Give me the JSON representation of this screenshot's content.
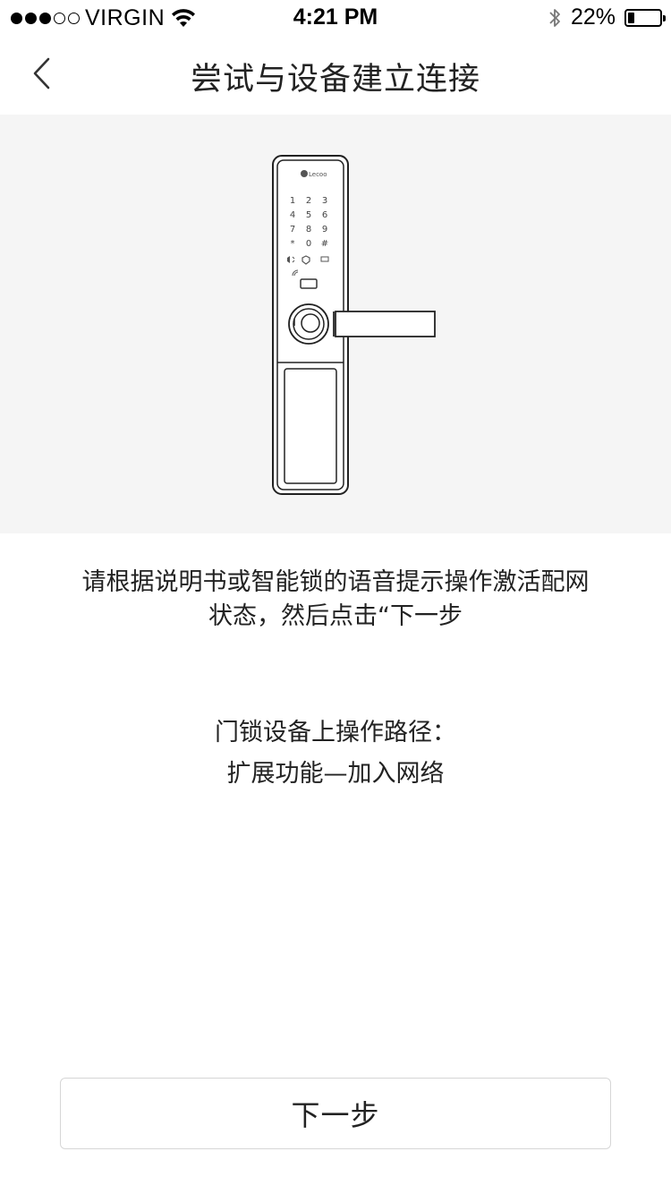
{
  "status_bar": {
    "carrier": "VIRGIN",
    "time": "4:21 PM",
    "battery_text": "22%",
    "battery_level": 0.22,
    "signal_filled": 3,
    "signal_total": 5
  },
  "nav": {
    "title": "尝试与设备建立连接",
    "back_icon": "chevron-left-icon"
  },
  "illustration": {
    "brand_text": "Lecoo",
    "keypad": [
      [
        "1",
        "2",
        "3"
      ],
      [
        "4",
        "5",
        "6"
      ],
      [
        "7",
        "8",
        "9"
      ],
      [
        "*",
        "0",
        "#"
      ]
    ]
  },
  "instruction": {
    "line1": "请根据说明书或智能锁的语音提示操作激活配网",
    "line2": "状态，然后点击“下一步"
  },
  "path": {
    "label": "门锁设备上操作路径：",
    "route": "扩展功能—加入网络"
  },
  "next_button": {
    "label": "下一步"
  }
}
